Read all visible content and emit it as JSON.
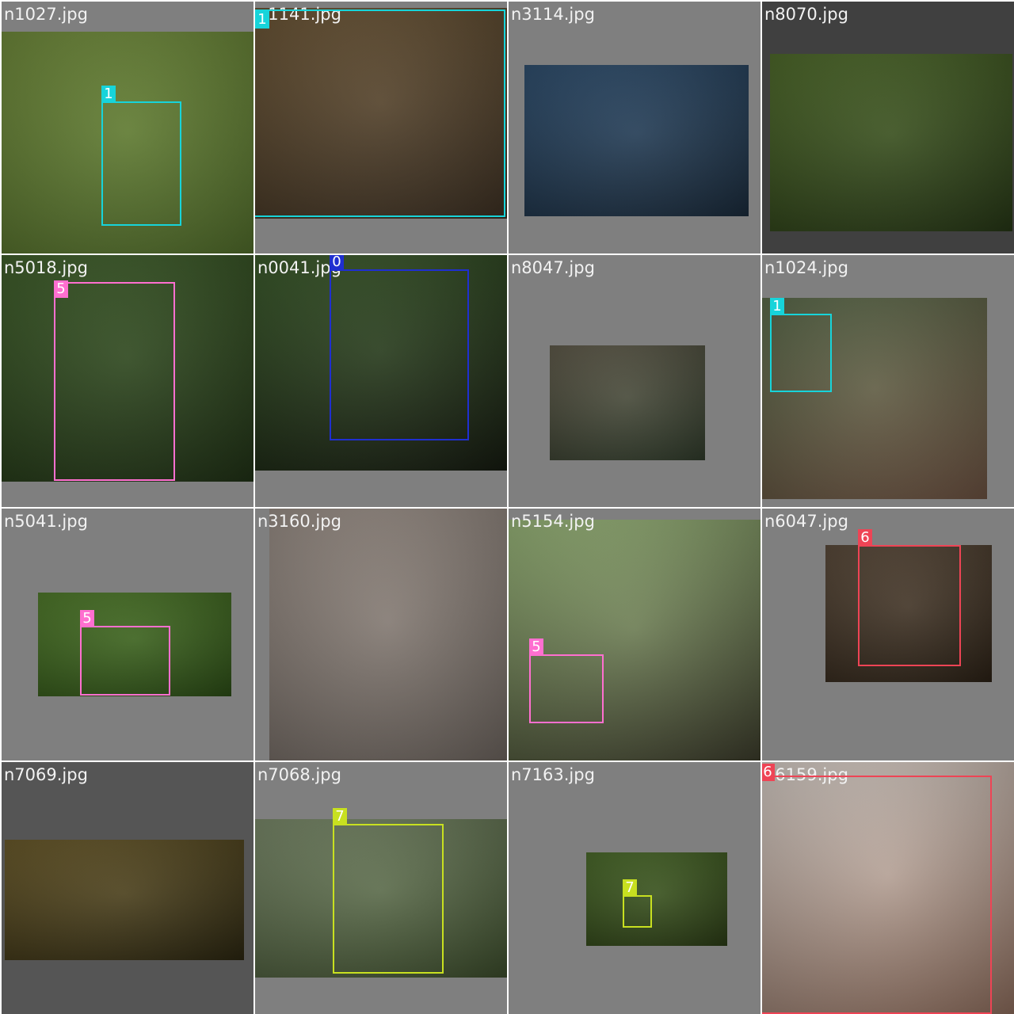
{
  "tiles": [
    {
      "filename": "n1027.jpg",
      "tile_bg": "#7f7f7f",
      "photo_colors": [
        "#6f8a3a",
        "#4f6a2a"
      ],
      "boxes": [
        {
          "label": "1",
          "color": "#17d4da"
        }
      ]
    },
    {
      "filename": "n1141.jpg",
      "tile_bg": "#7f7f7f",
      "photo_colors": [
        "#6b5535",
        "#3b2f22"
      ],
      "boxes": [
        {
          "label": "1",
          "color": "#17d4da"
        }
      ]
    },
    {
      "filename": "n3114.jpg",
      "tile_bg": "#7f7f7f",
      "photo_colors": [
        "#2f4f6f",
        "#1a2a3a"
      ],
      "boxes": []
    },
    {
      "filename": "n8070.jpg",
      "tile_bg": "#404040",
      "photo_colors": [
        "#4e6a2a",
        "#253515"
      ],
      "boxes": []
    },
    {
      "filename": "n5018.jpg",
      "tile_bg": "#7f7f7f",
      "photo_colors": [
        "#3f5f2a",
        "#1f3015"
      ],
      "boxes": [
        {
          "label": "5",
          "color": "#ff6fd0"
        }
      ]
    },
    {
      "filename": "n0041.jpg",
      "tile_bg": "#7f7f7f",
      "photo_colors": [
        "#3a5a2a",
        "#151a10"
      ],
      "boxes": [
        {
          "label": "0",
          "color": "#1f2fd0"
        }
      ]
    },
    {
      "filename": "n8047.jpg",
      "tile_bg": "#7f7f7f",
      "photo_colors": [
        "#5f5a4a",
        "#2f3a2a"
      ],
      "boxes": []
    },
    {
      "filename": "n1024.jpg",
      "tile_bg": "#7f7f7f",
      "photo_colors": [
        "#5a6a4a",
        "#6a5040"
      ],
      "boxes": [
        {
          "label": "1",
          "color": "#17d4da"
        }
      ]
    },
    {
      "filename": "n5041.jpg",
      "tile_bg": "#7f7f7f",
      "photo_colors": [
        "#4f7a2a",
        "#2a4a15"
      ],
      "boxes": [
        {
          "label": "5",
          "color": "#ff6fd0"
        }
      ]
    },
    {
      "filename": "n3160.jpg",
      "tile_bg": "#7f7f7f",
      "photo_colors": [
        "#9a8f87",
        "#6a625c"
      ],
      "boxes": []
    },
    {
      "filename": "n5154.jpg",
      "tile_bg": "#7f7f7f",
      "photo_colors": [
        "#9ab87a",
        "#3a3a2a"
      ],
      "boxes": [
        {
          "label": "5",
          "color": "#ff6fd0"
        }
      ]
    },
    {
      "filename": "n6047.jpg",
      "tile_bg": "#7f7f7f",
      "photo_colors": [
        "#5a4a3a",
        "#2a2015"
      ],
      "boxes": [
        {
          "label": "6",
          "color": "#ee4455"
        }
      ]
    },
    {
      "filename": "n7069.jpg",
      "tile_bg": "#555555",
      "photo_colors": [
        "#6a5a2a",
        "#2a2510"
      ],
      "boxes": []
    },
    {
      "filename": "n7068.jpg",
      "tile_bg": "#7f7f7f",
      "photo_colors": [
        "#7a8a6a",
        "#3a4a2a"
      ],
      "boxes": [
        {
          "label": "7",
          "color": "#c8e020"
        }
      ]
    },
    {
      "filename": "n7163.jpg",
      "tile_bg": "#7f7f7f",
      "photo_colors": [
        "#4a6a2a",
        "#2a3a15"
      ],
      "boxes": [
        {
          "label": "7",
          "color": "#c8e020"
        }
      ]
    },
    {
      "filename": "n6159.jpg",
      "tile_bg": "#7f7f7f",
      "photo_colors": [
        "#d8cfc8",
        "#8a6a5a"
      ],
      "boxes": [
        {
          "label": "6",
          "color": "#ee4455"
        }
      ]
    }
  ]
}
